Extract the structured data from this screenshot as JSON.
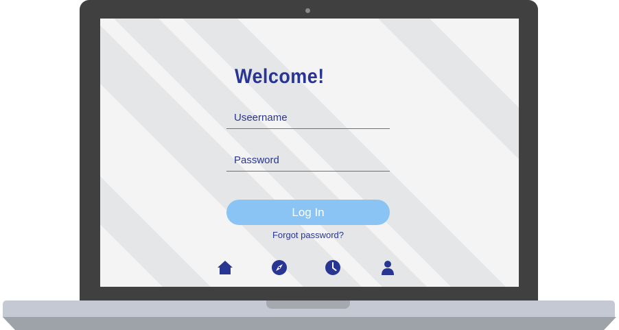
{
  "login": {
    "welcome_text": "Welcome!",
    "username_placeholder": "Useername",
    "password_placeholder": "Password",
    "login_button_label": "Log In",
    "forgot_password_link": "Forgot password?"
  },
  "bottom_nav": {
    "icons": [
      "home-icon",
      "compass-icon",
      "clock-icon",
      "user-icon"
    ]
  },
  "colors": {
    "primary_text": "#283593",
    "button": "#89c4f4",
    "screen_background": "#f4f4f5",
    "stripe": "#e5e6e8",
    "laptop_frame": "#404040"
  }
}
